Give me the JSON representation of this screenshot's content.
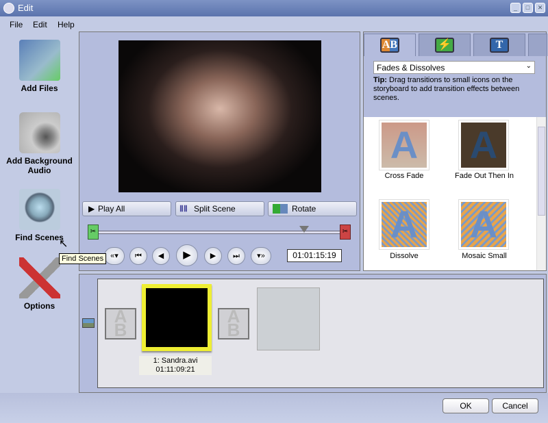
{
  "window": {
    "title": "Edit"
  },
  "menu": [
    "File",
    "Edit",
    "Help"
  ],
  "tools": [
    {
      "label": "Add Files",
      "icon": "add-files-icon"
    },
    {
      "label": "Add Background Audio",
      "icon": "add-audio-icon"
    },
    {
      "label": "Find Scenes",
      "icon": "find-scenes-icon"
    },
    {
      "label": "Options",
      "icon": "options-icon"
    }
  ],
  "tooltip": "Find Scenes",
  "player": {
    "play_all": "Play All",
    "split_scene": "Split Scene",
    "rotate": "Rotate",
    "timecode": "01:01:15:19",
    "position": 0.84
  },
  "transitions": {
    "tabs": [
      "AB",
      "⚡",
      "T"
    ],
    "category": "Fades & Dissolves",
    "tip_label": "Tip:",
    "tip": "Drag transitions to small icons on the storyboard to add transition effects between scenes.",
    "items": [
      "Cross Fade",
      "Fade Out Then In",
      "Dissolve",
      "Mosaic Small"
    ]
  },
  "storyboard": {
    "clip_name": "1: Sandra.avi",
    "clip_duration": "01:11:09:21"
  },
  "buttons": {
    "ok": "OK",
    "cancel": "Cancel"
  }
}
